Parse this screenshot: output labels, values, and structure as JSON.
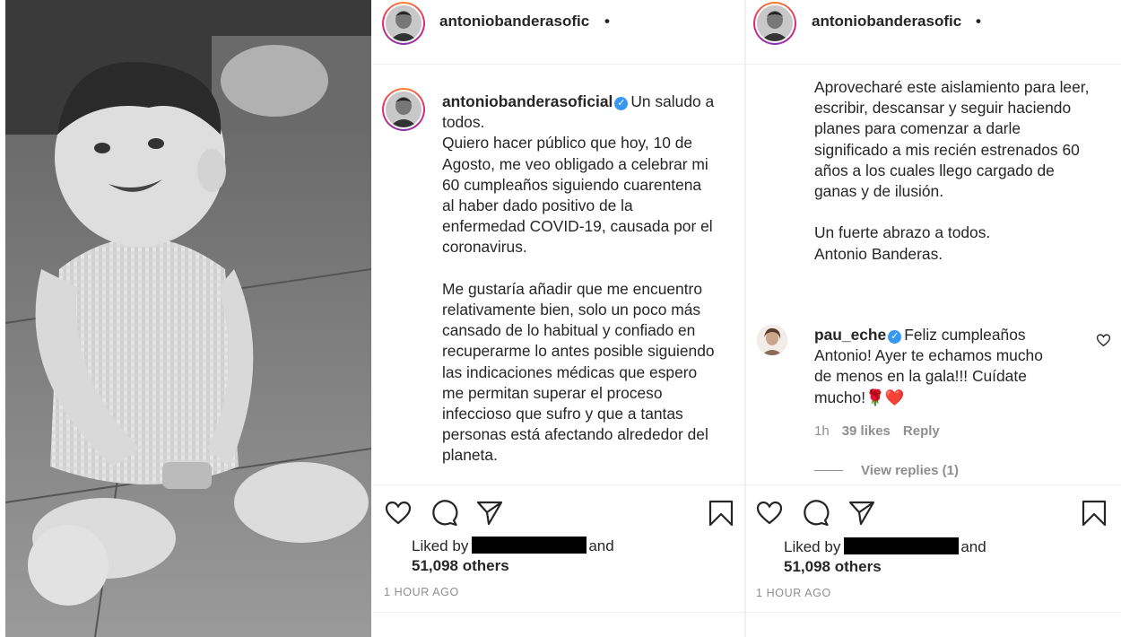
{
  "post": {
    "username": "antoniobanderasoficial",
    "username_truncated": "antoniobanderasofic",
    "header_dot": "•",
    "verified_icon": "✓",
    "caption_first": "Un saludo a",
    "caption_rest": "todos.\nQuiero hacer público que hoy, 10 de\nAgosto, me veo obligado a celebrar mi\n60 cumpleaños siguiendo cuarentena\nal haber dado positivo de la\nenfermedad COVID-19, causada por el\ncoronavirus.\n\nMe gustaría añadir que me encuentro\nrelativamente bien, solo un poco más\ncansado de lo habitual y confiado en\nrecuperarme lo antes posible siguiendo\nlas indicaciones médicas que espero\nme permitan superar el proceso\ninfeccioso que sufro y que a tantas\npersonas está afectando alrededor del\nplaneta.",
    "caption_continued": "Aprovecharé este aislamiento para leer,\nescribir, descansar y seguir haciendo\nplanes para comenzar a darle\nsignificado a mis recién estrenados 60\naños a los cuales llego cargado de\nganas y de ilusión.\n\nUn fuerte abrazo a todos.\nAntonio Banderas.",
    "liked_by": "Liked by",
    "and": "and",
    "others": "51,098 others",
    "time_ago": "1 HOUR AGO"
  },
  "comment": {
    "username": "pau_eche",
    "text_first": "Feliz cumpleaños",
    "text_rest": "Antonio! Ayer te echamos mucho\nde menos en la gala!!! Cuídate\nmucho!🌹❤️",
    "time": "1h",
    "likes": "39 likes",
    "reply": "Reply",
    "view_replies": "View replies (1)"
  },
  "icons": [
    "heart-icon",
    "comment-icon",
    "share-icon",
    "bookmark-icon",
    "verified-icon",
    "avatar"
  ],
  "colors": {
    "text": "#262626",
    "muted": "#8e8e8e",
    "verified": "#3897f0",
    "border": "#efefef"
  }
}
